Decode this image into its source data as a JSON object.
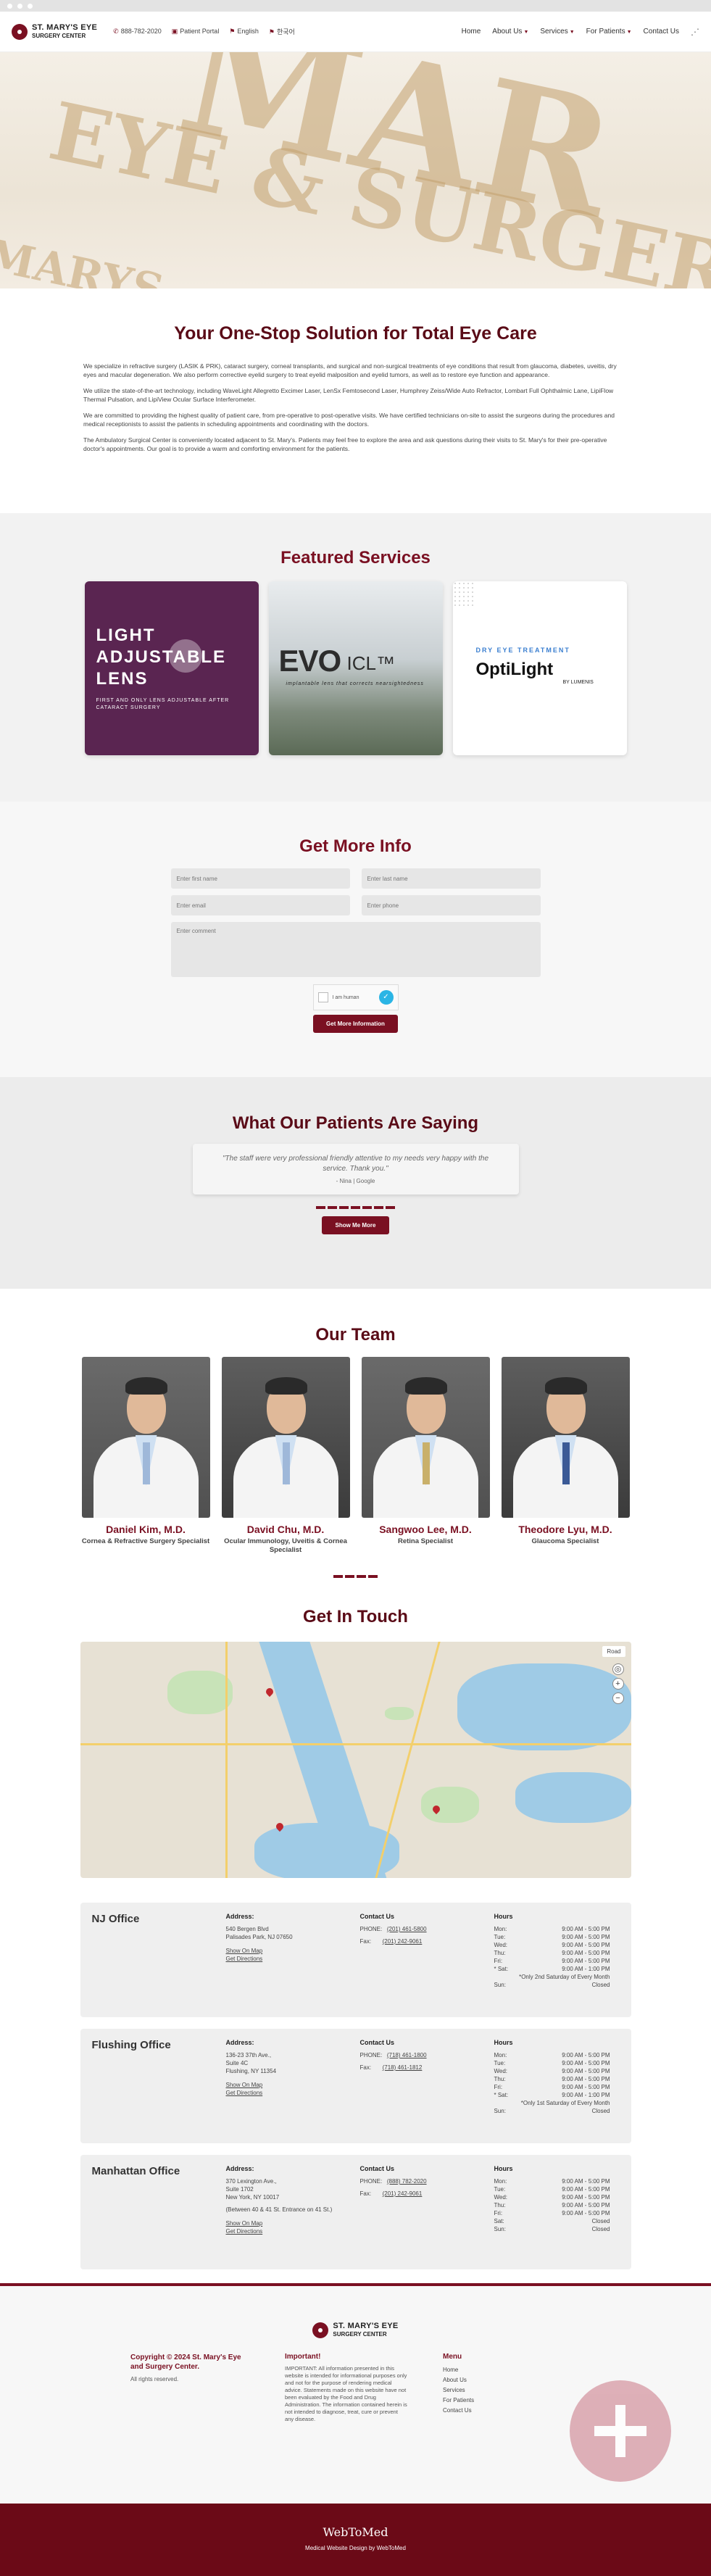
{
  "header": {
    "logo_line1": "ST. MARY'S EYE",
    "logo_line2": "SURGERY CENTER",
    "phone": "888-782-2020",
    "patient_portal": "Patient Portal",
    "lang_english": "English",
    "lang_korean": "한국어",
    "nav": [
      "Home",
      "About Us",
      "Services",
      "For Patients",
      "Contact Us"
    ]
  },
  "hero": {
    "watermark_line1": "MAR",
    "watermark_line2": "EYE & SURGERY",
    "watermark_line3": "MARYS"
  },
  "intro": {
    "title": "Your One-Stop Solution for Total Eye Care",
    "paragraphs": [
      "We specialize in refractive surgery (LASIK & PRK), cataract surgery, corneal transplants, and surgical and non-surgical treatments of eye conditions that result from glaucoma, diabetes, uveitis, dry eyes and macular degeneration. We also perform corrective eyelid surgery to treat eyelid malposition and eyelid tumors, as well as to restore eye function and appearance.",
      "We utilize the state-of-the-art technology, including WaveLight Allegretto Excimer Laser, LenSx Femtosecond Laser, Humphrey Zeiss/Wide Auto Refractor, Lombart Full Ophthalmic Lane, LipiFlow Thermal Pulsation, and LipiView Ocular Surface Interferometer.",
      "We are committed to providing the highest quality of patient care, from pre-operative to post-operative visits. We have certified technicians on-site to assist the surgeons during the procedures and medical receptionists to assist the patients in scheduling appointments and coordinating with the doctors.",
      "The Ambulatory Surgical Center is conveniently located adjacent to St. Mary's. Patients may feel free to explore the area and ask questions during their visits to St. Mary's for their pre-operative doctor's appointments. Our goal is to provide a warm and comforting environment for the patients."
    ]
  },
  "featured": {
    "title": "Featured Services",
    "card1": {
      "line1": "LIGHT",
      "line2": "ADJUSTABLE",
      "line3": "LENS",
      "sub": "FIRST AND ONLY LENS ADJUSTABLE AFTER CATARACT SURGERY"
    },
    "card2": {
      "evo": "EVO",
      "icl": "ICL™",
      "tag": "implantable lens that corrects nearsightedness"
    },
    "card3": {
      "dry": "DRY EYE TREATMENT",
      "opti": "OptiLight",
      "by": "BY LUMENIS"
    }
  },
  "info": {
    "title": "Get More Info",
    "first_name": "Enter first name",
    "last_name": "Enter last name",
    "email": "Enter email",
    "phone": "Enter phone",
    "comment": "Enter comment",
    "captcha": "I am human",
    "submit": "Get More Information"
  },
  "testimonials": {
    "title": "What Our Patients Are Saying",
    "quote": "\"The staff were very professional friendly attentive to my needs very happy with the service. Thank you.\"",
    "author": "- Nina | Google",
    "more": "Show Me More"
  },
  "team": {
    "title": "Our Team",
    "members": [
      {
        "name": "Daniel Kim, M.D.",
        "role": "Cornea & Refractive Surgery Specialist"
      },
      {
        "name": "David Chu, M.D.",
        "role": "Ocular Immunology, Uveitis & Cornea Specialist"
      },
      {
        "name": "Sangwoo Lee, M.D.",
        "role": "Retina Specialist"
      },
      {
        "name": "Theodore Lyu, M.D.",
        "role": "Glaucoma Specialist"
      }
    ]
  },
  "contact": {
    "title": "Get In Touch",
    "map_mode": "Road",
    "offices": [
      {
        "name": "NJ Office",
        "address_label": "Address:",
        "address": [
          "540 Bergen Blvd",
          "Palisades Park, NJ 07650"
        ],
        "show_map": "Show On Map",
        "directions": "Get Directions",
        "contact_label": "Contact Us",
        "phone_label": "PHONE:",
        "phone": "(201) 461-5800",
        "fax_label": "Fax:",
        "fax": "(201) 242-9061",
        "hours_label": "Hours",
        "hours": [
          [
            "Mon:",
            "9:00 AM - 5:00 PM"
          ],
          [
            "Tue:",
            "9:00 AM - 5:00 PM"
          ],
          [
            "Wed:",
            "9:00 AM - 5:00 PM"
          ],
          [
            "Thu:",
            "9:00 AM - 5:00 PM"
          ],
          [
            "Fri:",
            "9:00 AM - 5:00 PM"
          ],
          [
            "* Sat:",
            "9:00 AM - 1:00 PM"
          ]
        ],
        "note": "*Only 2nd Saturday of Every Month",
        "sun": [
          "Sun:",
          "Closed"
        ]
      },
      {
        "name": "Flushing Office",
        "address_label": "Address:",
        "address": [
          "136-23 37th Ave.,",
          "Suite 4C",
          "Flushing, NY 11354"
        ],
        "show_map": "Show On Map",
        "directions": "Get Directions",
        "contact_label": "Contact Us",
        "phone_label": "PHONE:",
        "phone": "(718) 461-1800",
        "fax_label": "Fax:",
        "fax": "(718) 461-1812",
        "hours_label": "Hours",
        "hours": [
          [
            "Mon:",
            "9:00 AM - 5:00 PM"
          ],
          [
            "Tue:",
            "9:00 AM - 5:00 PM"
          ],
          [
            "Wed:",
            "9:00 AM - 5:00 PM"
          ],
          [
            "Thu:",
            "9:00 AM - 5:00 PM"
          ],
          [
            "Fri:",
            "9:00 AM - 5:00 PM"
          ],
          [
            "* Sat:",
            "9:00 AM - 1:00 PM"
          ]
        ],
        "note": "*Only 1st Saturday of Every Month",
        "sun": [
          "Sun:",
          "Closed"
        ]
      },
      {
        "name": "Manhattan Office",
        "address_label": "Address:",
        "address": [
          "370 Lexington Ave.,",
          "Suite 1702",
          "New York, NY 10017",
          "",
          "(Between 40 & 41 St. Entrance on 41 St.)"
        ],
        "show_map": "Show On Map",
        "directions": "Get Directions",
        "contact_label": "Contact Us",
        "phone_label": "PHONE:",
        "phone": "(888) 782-2020",
        "fax_label": "Fax:",
        "fax": "(201) 242-9061",
        "hours_label": "Hours",
        "hours": [
          [
            "Mon:",
            "9:00 AM - 5:00 PM"
          ],
          [
            "Tue:",
            "9:00 AM - 5:00 PM"
          ],
          [
            "Wed:",
            "9:00 AM - 5:00 PM"
          ],
          [
            "Thu:",
            "9:00 AM - 5:00 PM"
          ],
          [
            "Fri:",
            "9:00 AM - 5:00 PM"
          ],
          [
            "Sat:",
            "Closed"
          ]
        ],
        "note": "",
        "sun": [
          "Sun:",
          "Closed"
        ]
      }
    ]
  },
  "footer": {
    "logo_line1": "ST. MARY'S EYE",
    "logo_line2": "SURGERY CENTER",
    "copyright": "Copyright © 2024 St. Mary's Eye and Surgery Center.",
    "rights": "All rights reserved.",
    "important_title": "Important!",
    "important_text": "IMPORTANT: All information presented in this website is intended for informational purposes only and not for the purpose of rendering medical advice. Statements made on this website have not been evaluated by the Food and Drug Administration. The information contained herein is not intended to diagnose, treat, cure or prevent any disease.",
    "menu_title": "Menu",
    "menu": [
      "Home",
      "About Us",
      "Services",
      "For Patients",
      "Contact Us"
    ],
    "brand": "WebToMed",
    "credit": "Medical Website Design by WebToMed"
  }
}
